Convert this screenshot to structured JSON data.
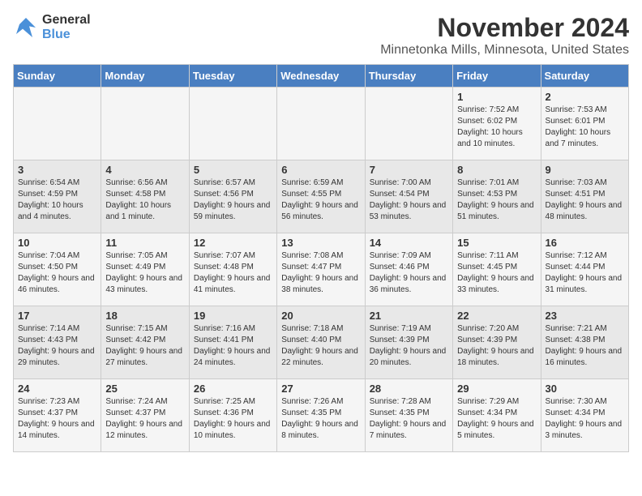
{
  "logo": {
    "general": "General",
    "blue": "Blue"
  },
  "title": "November 2024",
  "location": "Minnetonka Mills, Minnesota, United States",
  "headers": [
    "Sunday",
    "Monday",
    "Tuesday",
    "Wednesday",
    "Thursday",
    "Friday",
    "Saturday"
  ],
  "weeks": [
    [
      {
        "day": "",
        "info": ""
      },
      {
        "day": "",
        "info": ""
      },
      {
        "day": "",
        "info": ""
      },
      {
        "day": "",
        "info": ""
      },
      {
        "day": "",
        "info": ""
      },
      {
        "day": "1",
        "info": "Sunrise: 7:52 AM\nSunset: 6:02 PM\nDaylight: 10 hours and 10 minutes."
      },
      {
        "day": "2",
        "info": "Sunrise: 7:53 AM\nSunset: 6:01 PM\nDaylight: 10 hours and 7 minutes."
      }
    ],
    [
      {
        "day": "3",
        "info": "Sunrise: 6:54 AM\nSunset: 4:59 PM\nDaylight: 10 hours and 4 minutes."
      },
      {
        "day": "4",
        "info": "Sunrise: 6:56 AM\nSunset: 4:58 PM\nDaylight: 10 hours and 1 minute."
      },
      {
        "day": "5",
        "info": "Sunrise: 6:57 AM\nSunset: 4:56 PM\nDaylight: 9 hours and 59 minutes."
      },
      {
        "day": "6",
        "info": "Sunrise: 6:59 AM\nSunset: 4:55 PM\nDaylight: 9 hours and 56 minutes."
      },
      {
        "day": "7",
        "info": "Sunrise: 7:00 AM\nSunset: 4:54 PM\nDaylight: 9 hours and 53 minutes."
      },
      {
        "day": "8",
        "info": "Sunrise: 7:01 AM\nSunset: 4:53 PM\nDaylight: 9 hours and 51 minutes."
      },
      {
        "day": "9",
        "info": "Sunrise: 7:03 AM\nSunset: 4:51 PM\nDaylight: 9 hours and 48 minutes."
      }
    ],
    [
      {
        "day": "10",
        "info": "Sunrise: 7:04 AM\nSunset: 4:50 PM\nDaylight: 9 hours and 46 minutes."
      },
      {
        "day": "11",
        "info": "Sunrise: 7:05 AM\nSunset: 4:49 PM\nDaylight: 9 hours and 43 minutes."
      },
      {
        "day": "12",
        "info": "Sunrise: 7:07 AM\nSunset: 4:48 PM\nDaylight: 9 hours and 41 minutes."
      },
      {
        "day": "13",
        "info": "Sunrise: 7:08 AM\nSunset: 4:47 PM\nDaylight: 9 hours and 38 minutes."
      },
      {
        "day": "14",
        "info": "Sunrise: 7:09 AM\nSunset: 4:46 PM\nDaylight: 9 hours and 36 minutes."
      },
      {
        "day": "15",
        "info": "Sunrise: 7:11 AM\nSunset: 4:45 PM\nDaylight: 9 hours and 33 minutes."
      },
      {
        "day": "16",
        "info": "Sunrise: 7:12 AM\nSunset: 4:44 PM\nDaylight: 9 hours and 31 minutes."
      }
    ],
    [
      {
        "day": "17",
        "info": "Sunrise: 7:14 AM\nSunset: 4:43 PM\nDaylight: 9 hours and 29 minutes."
      },
      {
        "day": "18",
        "info": "Sunrise: 7:15 AM\nSunset: 4:42 PM\nDaylight: 9 hours and 27 minutes."
      },
      {
        "day": "19",
        "info": "Sunrise: 7:16 AM\nSunset: 4:41 PM\nDaylight: 9 hours and 24 minutes."
      },
      {
        "day": "20",
        "info": "Sunrise: 7:18 AM\nSunset: 4:40 PM\nDaylight: 9 hours and 22 minutes."
      },
      {
        "day": "21",
        "info": "Sunrise: 7:19 AM\nSunset: 4:39 PM\nDaylight: 9 hours and 20 minutes."
      },
      {
        "day": "22",
        "info": "Sunrise: 7:20 AM\nSunset: 4:39 PM\nDaylight: 9 hours and 18 minutes."
      },
      {
        "day": "23",
        "info": "Sunrise: 7:21 AM\nSunset: 4:38 PM\nDaylight: 9 hours and 16 minutes."
      }
    ],
    [
      {
        "day": "24",
        "info": "Sunrise: 7:23 AM\nSunset: 4:37 PM\nDaylight: 9 hours and 14 minutes."
      },
      {
        "day": "25",
        "info": "Sunrise: 7:24 AM\nSunset: 4:37 PM\nDaylight: 9 hours and 12 minutes."
      },
      {
        "day": "26",
        "info": "Sunrise: 7:25 AM\nSunset: 4:36 PM\nDaylight: 9 hours and 10 minutes."
      },
      {
        "day": "27",
        "info": "Sunrise: 7:26 AM\nSunset: 4:35 PM\nDaylight: 9 hours and 8 minutes."
      },
      {
        "day": "28",
        "info": "Sunrise: 7:28 AM\nSunset: 4:35 PM\nDaylight: 9 hours and 7 minutes."
      },
      {
        "day": "29",
        "info": "Sunrise: 7:29 AM\nSunset: 4:34 PM\nDaylight: 9 hours and 5 minutes."
      },
      {
        "day": "30",
        "info": "Sunrise: 7:30 AM\nSunset: 4:34 PM\nDaylight: 9 hours and 3 minutes."
      }
    ]
  ]
}
